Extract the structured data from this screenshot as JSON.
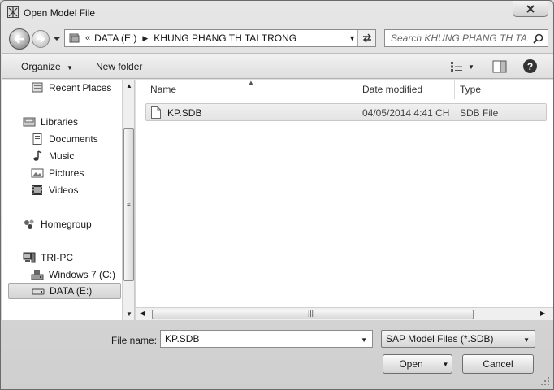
{
  "window": {
    "title": "Open Model File"
  },
  "navigation": {
    "address_segments": [
      "DATA (E:)",
      "KHUNG PHANG TH TAI TRONG"
    ],
    "address_overflow": "«",
    "search_placeholder": "Search KHUNG PHANG TH TA..."
  },
  "toolbar": {
    "organize_label": "Organize",
    "new_folder_label": "New folder",
    "help_label": "?"
  },
  "nav_pane": {
    "items": [
      {
        "label": "Recent Places",
        "icon": "recent-places-icon"
      },
      {
        "label": "Libraries",
        "icon": "libraries-icon"
      },
      {
        "label": "Documents",
        "icon": "documents-icon"
      },
      {
        "label": "Music",
        "icon": "music-icon"
      },
      {
        "label": "Pictures",
        "icon": "pictures-icon"
      },
      {
        "label": "Videos",
        "icon": "videos-icon"
      },
      {
        "label": "Homegroup",
        "icon": "homegroup-icon"
      },
      {
        "label": "TRI-PC",
        "icon": "computer-icon"
      },
      {
        "label": "Windows 7 (C:)",
        "icon": "drive-c-icon"
      },
      {
        "label": "DATA (E:)",
        "icon": "drive-icon",
        "selected": true
      }
    ]
  },
  "file_list": {
    "columns": [
      "Name",
      "Date modified",
      "Type"
    ],
    "rows": [
      {
        "name": "KP.SDB",
        "date": "04/05/2014 4:41 CH",
        "type": "SDB File"
      }
    ]
  },
  "bottom": {
    "file_name_label": "File name:",
    "file_name_value": "KP.SDB",
    "file_type_value": "SAP Model Files (*.SDB)",
    "open_label": "Open",
    "cancel_label": "Cancel"
  },
  "colors": {
    "selection": "#e4e4e4",
    "window_bg": "#d8d8d8"
  }
}
